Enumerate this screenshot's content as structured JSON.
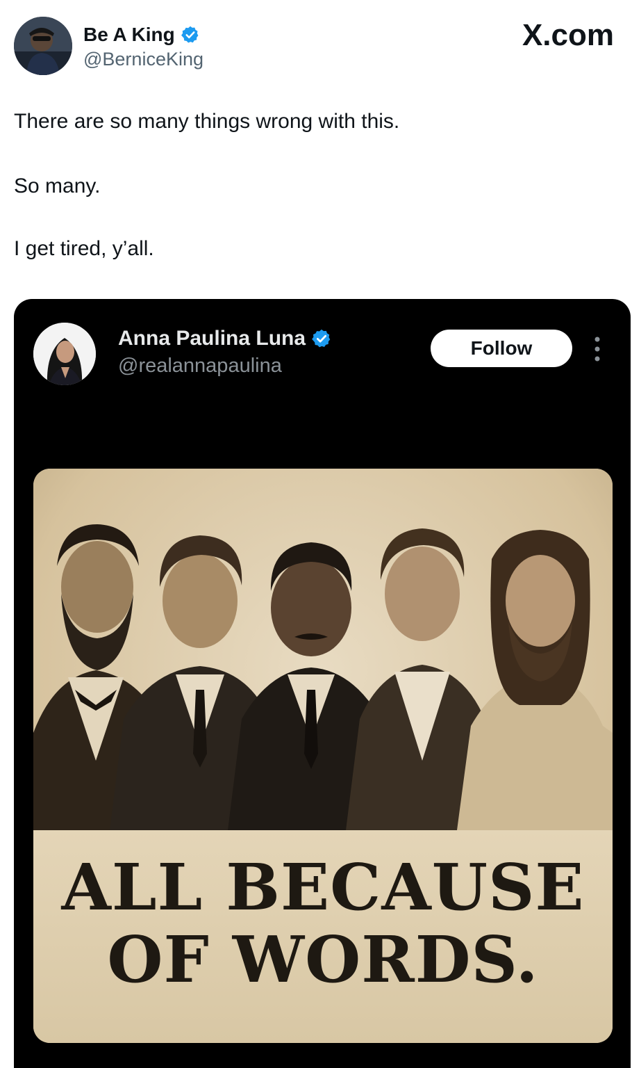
{
  "author": {
    "name": "Be A King",
    "handle": "@BerniceKing",
    "verified": true
  },
  "brand": {
    "label": "X.com"
  },
  "tweet": {
    "lines": [
      "There are so many things wrong with this.",
      "So many.",
      "I get tired, y’all."
    ]
  },
  "embedded_tweet": {
    "name": "Anna Paulina Luna",
    "handle": "@realannapaulina",
    "verified": true,
    "follow_label": "Follow",
    "image": {
      "caption_line_1": "ALL BECAUSE",
      "caption_line_2": "OF WORDS."
    }
  },
  "colors": {
    "verified_blue": "#1d9bf0",
    "embed_background": "#000000",
    "sepia": "#d9c6a4"
  }
}
